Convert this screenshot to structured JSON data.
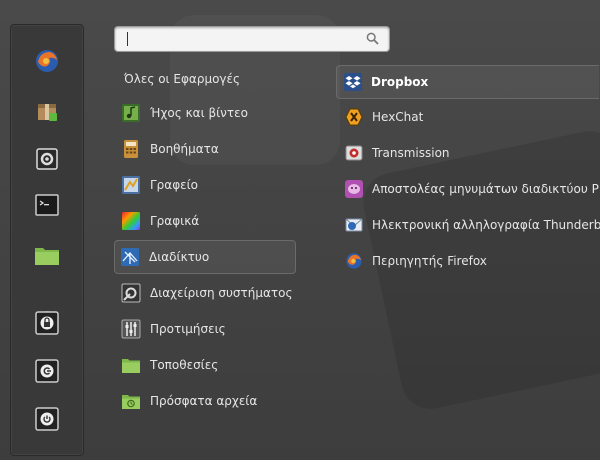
{
  "search": {
    "value": "",
    "icon": "magnifier-icon"
  },
  "favorites": [
    {
      "name": "firefox",
      "icon": "firefox-icon"
    },
    {
      "name": "package-installer",
      "icon": "package-icon"
    },
    {
      "name": "system-settings",
      "icon": "settings-icon"
    },
    {
      "name": "terminal",
      "icon": "terminal-icon"
    },
    {
      "name": "home-folder",
      "icon": "folder-icon"
    },
    {
      "name": "lock-screen",
      "icon": "lock-icon"
    },
    {
      "name": "logout",
      "icon": "logout-icon"
    },
    {
      "name": "shutdown",
      "icon": "power-icon"
    }
  ],
  "categories": [
    {
      "label": "Όλες οι Εφαρμογές"
    },
    {
      "label": "Ήχος και βίντεο"
    },
    {
      "label": "Βοηθήματα"
    },
    {
      "label": "Γραφείο"
    },
    {
      "label": "Γραφικά"
    },
    {
      "label": "Διαδίκτυο"
    },
    {
      "label": "Διαχείριση συστήματος"
    },
    {
      "label": "Προτιμήσεις"
    },
    {
      "label": "Τοποθεσίες"
    },
    {
      "label": "Πρόσφατα αρχεία"
    }
  ],
  "apps": [
    {
      "label": "Dropbox"
    },
    {
      "label": "HexChat"
    },
    {
      "label": "Transmission"
    },
    {
      "label": "Αποστολέας μηνυμάτων διαδικτύου P"
    },
    {
      "label": "Ηλεκτρονική αλληλογραφία Thunderb"
    },
    {
      "label": "Περιηγητής Firefox"
    }
  ],
  "selected_category": "Διαδίκτυο",
  "selected_app": "Dropbox"
}
